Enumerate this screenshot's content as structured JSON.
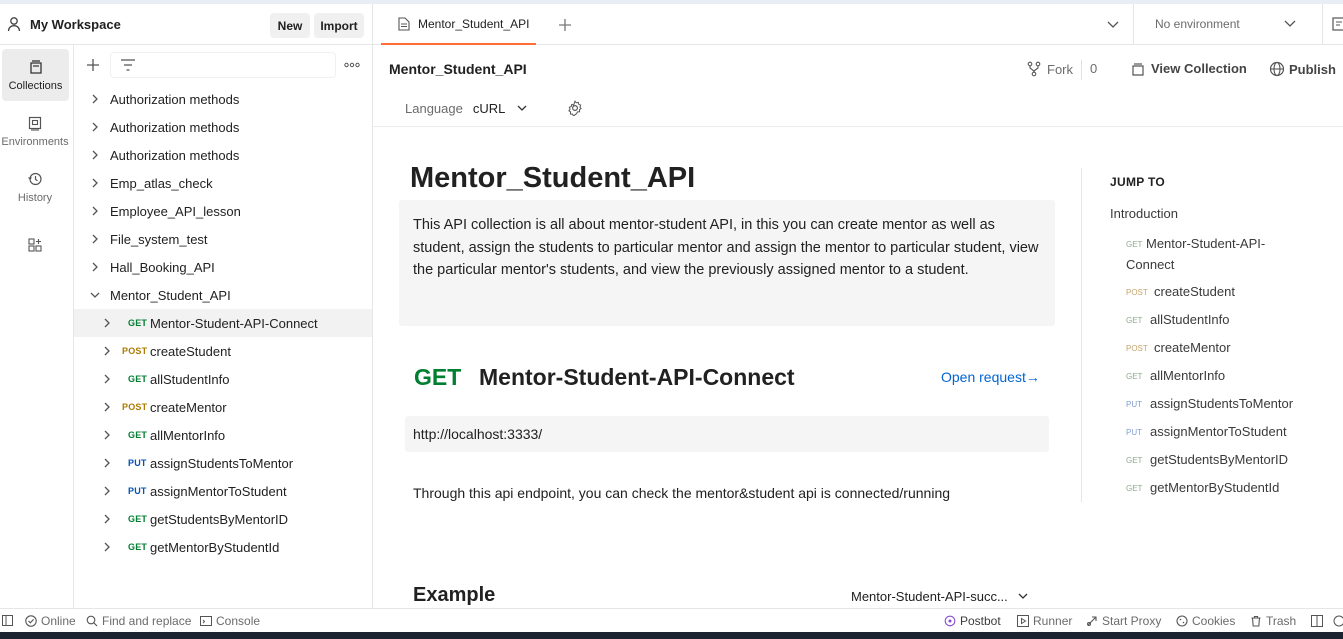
{
  "workspace": {
    "title": "My Workspace",
    "new_label": "New",
    "import_label": "Import"
  },
  "rail": {
    "items": [
      {
        "label": "Collections",
        "icon": "collections-icon"
      },
      {
        "label": "Environments",
        "icon": "environments-icon"
      },
      {
        "label": "History",
        "icon": "history-icon"
      },
      {
        "label": "",
        "icon": "configure-workbench-icon"
      }
    ]
  },
  "sidebar": {
    "collections": [
      "Authorization methods",
      "Authorization methods",
      "Authorization methods",
      "Emp_atlas_check",
      "Employee_API_lesson",
      "File_system_test",
      "Hall_Booking_API",
      "Mentor_Student_API"
    ],
    "requests": [
      {
        "method": "GET",
        "name": "Mentor-Student-API-Connect"
      },
      {
        "method": "POST",
        "name": "createStudent"
      },
      {
        "method": "GET",
        "name": "allStudentInfo"
      },
      {
        "method": "POST",
        "name": "createMentor"
      },
      {
        "method": "GET",
        "name": "allMentorInfo"
      },
      {
        "method": "PUT",
        "name": "assignStudentsToMentor"
      },
      {
        "method": "PUT",
        "name": "assignMentorToStudent"
      },
      {
        "method": "GET",
        "name": "getStudentsByMentorID"
      },
      {
        "method": "GET",
        "name": "getMentorByStudentId"
      }
    ]
  },
  "tabs": {
    "active_tab": "Mentor_Student_API",
    "environment": "No environment"
  },
  "collection": {
    "title": "Mentor_Student_API",
    "fork_label": "Fork",
    "fork_count": "0",
    "view_label": "View Collection",
    "publish_label": "Publish",
    "language_label": "Language",
    "language_value": "cURL"
  },
  "doc": {
    "title": "Mentor_Student_API",
    "description": "This API collection is all about mentor-student API, in this you can create mentor as well as student, assign the students to particular mentor and assign the mentor to particular student, view the particular mentor's students, and view the previously assigned mentor to a student.",
    "request": {
      "method": "GET",
      "name": "Mentor-Student-API-Connect",
      "open_label": "Open request→",
      "url": "http://localhost:3333/",
      "description": "Through this api endpoint, you can check the mentor&student api is connected/running"
    },
    "example_title": "Example",
    "example_selected": "Mentor-Student-API-succ..."
  },
  "jump": {
    "title": "JUMP TO",
    "intro": "Introduction",
    "items": [
      {
        "method": "GET",
        "name": "Mentor-Student-API-Connect"
      },
      {
        "method": "POST",
        "name": "createStudent"
      },
      {
        "method": "GET",
        "name": "allStudentInfo"
      },
      {
        "method": "POST",
        "name": "createMentor"
      },
      {
        "method": "GET",
        "name": "allMentorInfo"
      },
      {
        "method": "PUT",
        "name": "assignStudentsToMentor"
      },
      {
        "method": "PUT",
        "name": "assignMentorToStudent"
      },
      {
        "method": "GET",
        "name": "getStudentsByMentorID"
      },
      {
        "method": "GET",
        "name": "getMentorByStudentId"
      }
    ]
  },
  "statusbar": {
    "online": "Online",
    "find_replace": "Find and replace",
    "console": "Console",
    "postbot": "Postbot",
    "runner": "Runner",
    "start_proxy": "Start Proxy",
    "cookies": "Cookies",
    "trash": "Trash"
  },
  "colors": {
    "get": "#007f31",
    "post": "#ad7a03",
    "put": "#0053b8",
    "accent": "#ff6c37",
    "link": "#0265d2"
  }
}
